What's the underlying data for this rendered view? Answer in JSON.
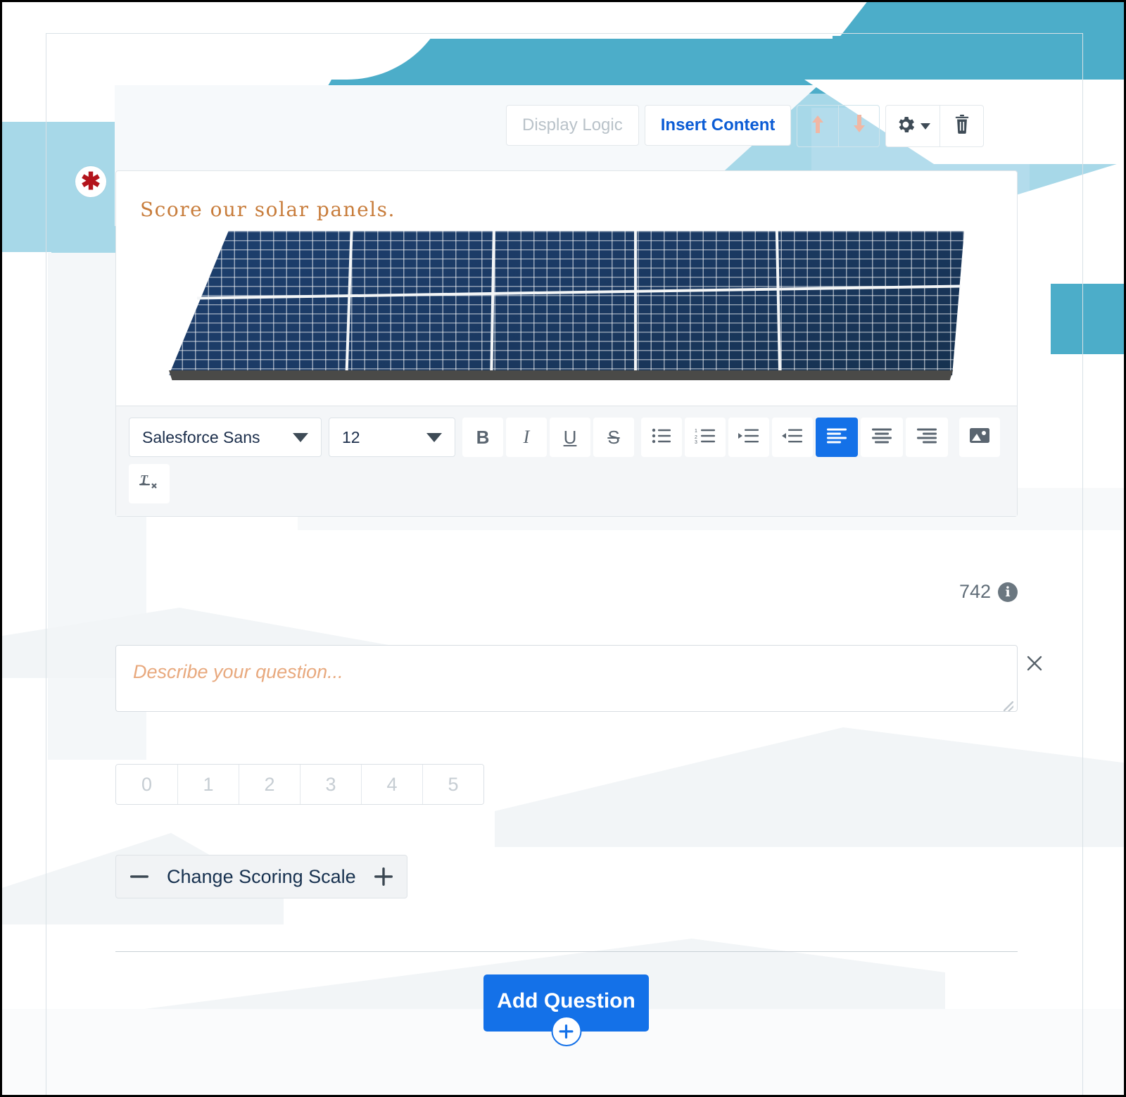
{
  "header": {
    "display_logic_label": "Display Logic",
    "insert_content_label": "Insert Content",
    "move_up_icon": "arrow-up-icon",
    "move_down_icon": "arrow-down-icon",
    "settings_icon": "gear-icon",
    "settings_caret_icon": "chevron-down-icon",
    "delete_icon": "trash-icon"
  },
  "question": {
    "required_marker": "✱",
    "title": "Score our solar panels.",
    "image_alt": "solar-panel-image"
  },
  "editor": {
    "font_family_value": "Salesforce Sans",
    "font_size_value": "12",
    "buttons": [
      {
        "name": "bold-button",
        "glyph": "B",
        "active": false
      },
      {
        "name": "italic-button",
        "glyph": "I",
        "active": false
      },
      {
        "name": "underline-button",
        "glyph": "U",
        "active": false
      },
      {
        "name": "strikethrough-button",
        "glyph": "S",
        "active": false
      },
      {
        "name": "bulleted-list-button",
        "glyph": "",
        "active": false
      },
      {
        "name": "numbered-list-button",
        "glyph": "",
        "active": false
      },
      {
        "name": "indent-button",
        "glyph": "",
        "active": false
      },
      {
        "name": "outdent-button",
        "glyph": "",
        "active": false
      },
      {
        "name": "align-left-button",
        "glyph": "",
        "active": true
      },
      {
        "name": "align-center-button",
        "glyph": "",
        "active": false
      },
      {
        "name": "align-right-button",
        "glyph": "",
        "active": false
      },
      {
        "name": "insert-image-button",
        "glyph": "",
        "active": false
      },
      {
        "name": "remove-formatting-button",
        "glyph": "",
        "active": false
      }
    ]
  },
  "char_counter": {
    "count": "742",
    "info_glyph": "i"
  },
  "description": {
    "value": "",
    "placeholder": "Describe your question...",
    "close_icon": "close-icon"
  },
  "scale": {
    "options": [
      "0",
      "1",
      "2",
      "3",
      "4",
      "5"
    ]
  },
  "scoring_scale": {
    "decrement_label": "—",
    "label": "Change Scoring Scale",
    "increment_label": "+"
  },
  "footer": {
    "add_question_label": "Add Question",
    "add_question_plus_icon": "plus-circle-icon"
  },
  "colors": {
    "accent_blue": "#1471e8",
    "link_blue": "#0b5cd5",
    "required_red": "#b3141c",
    "title_orange": "#c87d3c",
    "placeholder_orange": "#e8a97e",
    "sky_blue": "#4cadc9",
    "sky_blue_light": "#a7d8e8",
    "panel_blue": "#1d3f6e"
  }
}
